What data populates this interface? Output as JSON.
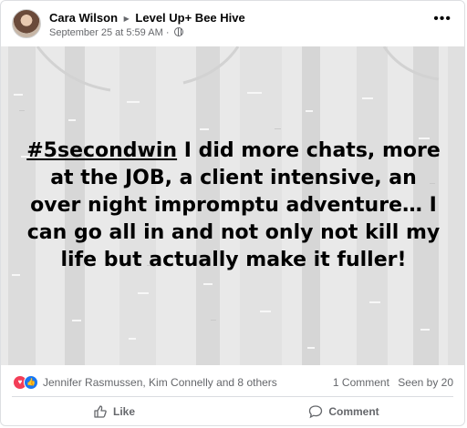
{
  "post": {
    "author": "Cara Wilson",
    "group": "Level Up+ Bee Hive",
    "timestamp": "September 25 at 5:59 AM",
    "separator": "·",
    "more_label": "•••"
  },
  "image_text": {
    "hashtag": "#5secondwin",
    "body": " I did more chats, more at the JOB, a client intensive, an over night impromptu adventure… I can go all in and not only not kill my life but actually make it fuller!"
  },
  "reactions": {
    "names": "Jennifer Rasmussen, Kim Connelly and 8 others",
    "comments": "1 Comment",
    "seen": "Seen by 20"
  },
  "actions": {
    "like": "Like",
    "comment": "Comment"
  },
  "colors": {
    "love": "#f33e58",
    "like": "#1877f2",
    "secondary_text": "#65676b"
  }
}
